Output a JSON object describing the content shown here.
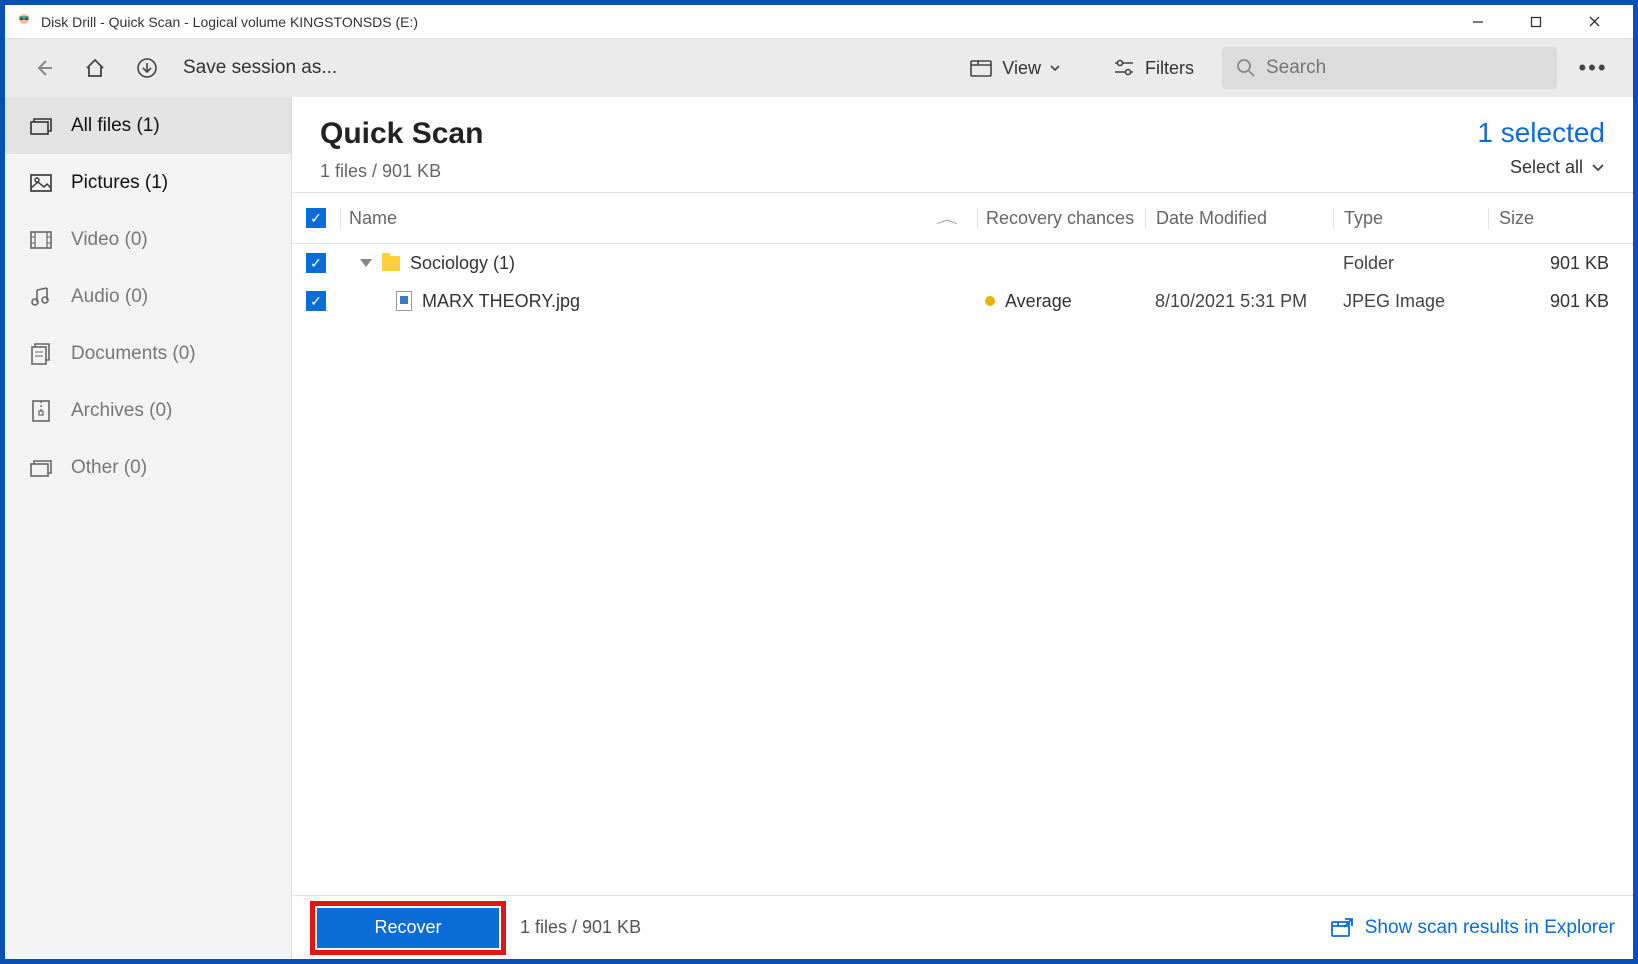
{
  "window": {
    "title": "Disk Drill - Quick Scan - Logical volume KINGSTONSDS (E:)"
  },
  "toolbar": {
    "save_label": "Save session as...",
    "view_label": "View",
    "filters_label": "Filters",
    "search_placeholder": "Search"
  },
  "sidebar": {
    "items": [
      {
        "label": "All files (1)"
      },
      {
        "label": "Pictures (1)"
      },
      {
        "label": "Video (0)"
      },
      {
        "label": "Audio (0)"
      },
      {
        "label": "Documents (0)"
      },
      {
        "label": "Archives (0)"
      },
      {
        "label": "Other (0)"
      }
    ]
  },
  "content": {
    "title": "Quick Scan",
    "subtitle": "1 files / 901 KB",
    "selected_text": "1 selected",
    "select_all": "Select all"
  },
  "columns": {
    "name": "Name",
    "recovery": "Recovery chances",
    "date": "Date Modified",
    "type": "Type",
    "size": "Size"
  },
  "rows": [
    {
      "name": "Sociology (1)",
      "recovery": "",
      "date": "",
      "type": "Folder",
      "size": "901 KB",
      "kind": "folder"
    },
    {
      "name": "MARX THEORY.jpg",
      "recovery": "Average",
      "recovery_color": "#e8b400",
      "date": "8/10/2021 5:31 PM",
      "type": "JPEG Image",
      "size": "901 KB",
      "kind": "file"
    }
  ],
  "footer": {
    "recover_label": "Recover",
    "info": "1 files / 901 KB",
    "explorer_link": "Show scan results in Explorer"
  }
}
